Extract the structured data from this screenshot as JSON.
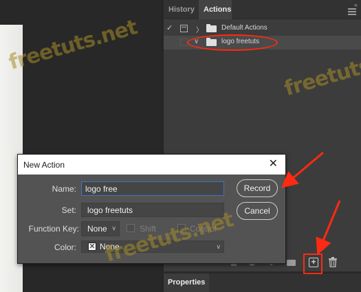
{
  "panel": {
    "tabs": [
      {
        "label": "History"
      },
      {
        "label": "Actions"
      }
    ],
    "collapse_glyph": "«",
    "close_glyph": "×",
    "action_rows": [
      {
        "label": "Default Actions",
        "checked": true
      },
      {
        "label": "logo freetuts",
        "checked": false
      }
    ],
    "toolbar_icons": [
      "stop-icon",
      "record-icon",
      "play-icon",
      "new-set-icon",
      "new-action-icon",
      "delete-icon"
    ]
  },
  "properties_panel": {
    "tab_label": "Properties"
  },
  "dialog": {
    "title": "New Action",
    "close_glyph": "✕",
    "name_label": "Name:",
    "name_value": "logo free",
    "set_label": "Set:",
    "set_value": "logo freetuts",
    "function_key_label": "Function Key:",
    "function_key_value": "None",
    "shift_label": "Shift",
    "control_label": "Control",
    "color_label": "Color:",
    "color_value": "None",
    "record_button": "Record",
    "cancel_button": "Cancel"
  },
  "watermarks": [
    "freetuts.net",
    "freetuts",
    "freetuts.net"
  ],
  "colors": {
    "annotation_red": "#ff2a12",
    "focus_blue": "#3b77c6",
    "panel_bg": "#3c3c3c",
    "dialog_bg": "#535353"
  }
}
